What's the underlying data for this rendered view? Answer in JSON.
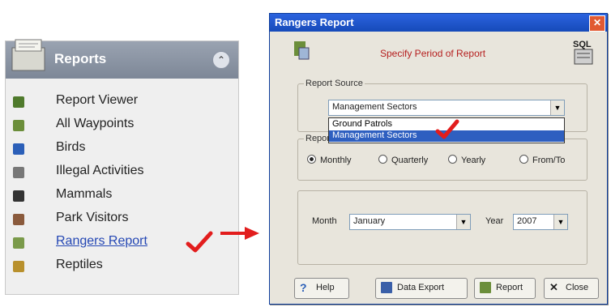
{
  "reports_panel": {
    "title": "Reports",
    "collapse_icon": "chevron-up-icon",
    "items": [
      {
        "label": "Report Viewer",
        "icon": "report-viewer-icon",
        "color": "#4f7a2c"
      },
      {
        "label": "All Waypoints",
        "icon": "waypoints-icon",
        "color": "#6b8e3a"
      },
      {
        "label": "Birds",
        "icon": "birds-icon",
        "color": "#2b5fb8"
      },
      {
        "label": "Illegal Activities",
        "icon": "illegal-activities-icon",
        "color": "#777777"
      },
      {
        "label": "Mammals",
        "icon": "mammals-icon",
        "color": "#333333"
      },
      {
        "label": "Park Visitors",
        "icon": "park-visitors-icon",
        "color": "#8a5a3c"
      },
      {
        "label": "Rangers Report",
        "icon": "rangers-report-icon",
        "color": "#7a9a4a",
        "selected": true
      },
      {
        "label": "Reptiles",
        "icon": "reptiles-icon",
        "color": "#b8902c"
      }
    ]
  },
  "dialog": {
    "title": "Rangers Report",
    "header_text": "Specify Period of Report",
    "sql_icon": "sql-icon",
    "report_source": {
      "legend": "Report Source",
      "selected": "Management Sectors",
      "options": [
        "Ground Patrols",
        "Management Sectors"
      ]
    },
    "report_period": {
      "legend": "Report Period",
      "options": [
        "Monthly",
        "Quarterly",
        "Yearly",
        "From/To"
      ],
      "selected": "Monthly"
    },
    "month_label": "Month",
    "month_value": "January",
    "year_label": "Year",
    "year_value": "2007",
    "buttons": {
      "help": "Help",
      "data_export": "Data Export",
      "report": "Report",
      "close": "Close"
    }
  },
  "colors": {
    "titlebar": "#1f55cc",
    "checkmark": "#e21d1d",
    "dialog_bg": "#e8e5dc",
    "panel_header": "#8a93a3"
  }
}
